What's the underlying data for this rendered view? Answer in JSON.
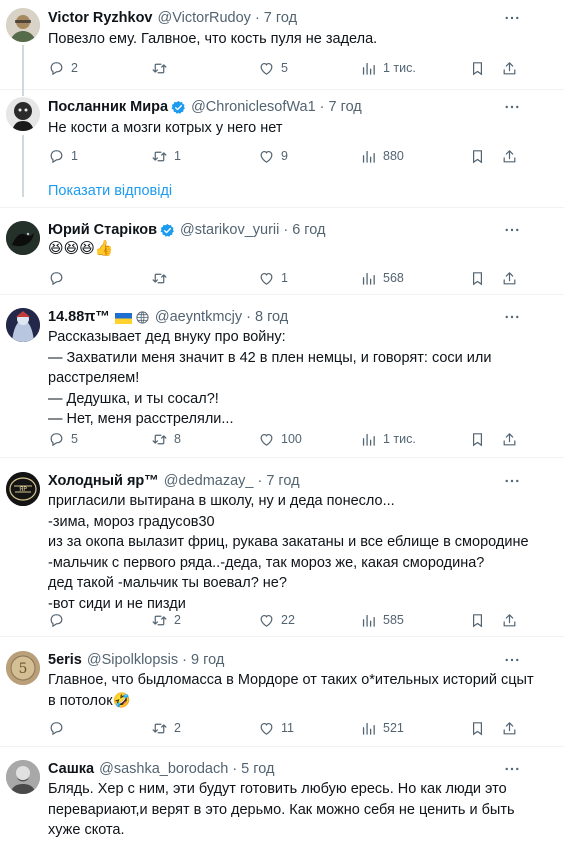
{
  "tweets": [
    {
      "name": "Victor Ryzhkov",
      "handle": "@VictorRudoy",
      "time": "7 год",
      "text": [
        "Повезло ему. Галвное, что кость пуля не задела."
      ],
      "replies": "2",
      "retweets": "",
      "likes": "5",
      "views": "1 тис."
    },
    {
      "name": "Посланник Мира",
      "handle": "@ChroniclesofWa1",
      "time": "7 год",
      "verified": true,
      "text": [
        "Не кости а мозги котрых у него нет"
      ],
      "replies": "1",
      "retweets": "1",
      "likes": "9",
      "views": "880"
    },
    {
      "name": "Юрий Старіков",
      "handle": "@starikov_yurii",
      "time": "6 год",
      "verified": true,
      "text": [
        "😆😆😆👍"
      ],
      "replies": "",
      "retweets": "",
      "likes": "1",
      "views": "568"
    },
    {
      "name": "14.88π™",
      "handle": "@aeyntkmcjy",
      "time": "8 год",
      "text": [
        "Рассказывает дед внуку про войну:",
        "— Захватили меня значит в 42 в плен немцы, и говорят: соси или",
        "расстреляем!",
        "— Дедушка, и ты сосал?!",
        "— Нет, меня расстреляли..."
      ],
      "replies": "5",
      "retweets": "8",
      "likes": "100",
      "views": "1 тис."
    },
    {
      "name": "Холодный яр™",
      "handle": "@dedmazay_",
      "time": "7 год",
      "text": [
        "пригласили вытирана в школу, ну и деда понесло...",
        "-зима, мороз градусов30",
        "из за окопа вылазит фриц, рукава закатаны и все еблище в смородине",
        "-мальчик с первого ряда..-деда, так мороз же, какая смородина?",
        "дед такой -мальчик ты воевал? не?",
        "-вот сиди и не пизди"
      ],
      "replies": "",
      "retweets": "2",
      "likes": "22",
      "views": "585"
    },
    {
      "name": "5eris",
      "handle": "@Sipolklopsis",
      "time": "9 год",
      "text": [
        "Главное, что быдломасса в Мордоре от таких о*ительных историй сцыт",
        "в потолок🤣"
      ],
      "replies": "",
      "retweets": "2",
      "likes": "11",
      "views": "521"
    },
    {
      "name": "Сашка",
      "handle": "@sashka_borodach",
      "time": "5 год",
      "text": [
        "Блядь. Хер с ним, эти будут готовить любую ересь. Но как люди это",
        "перевариают,и верят в это дерьмо. Как можно себя не ценить и быть",
        "хуже скота."
      ]
    }
  ],
  "show_replies": "Показати відповіді",
  "colors": {
    "accent": "#1d9bf0",
    "muted": "#536471",
    "text": "#0f1419",
    "verified": "#1d9bf0"
  },
  "icons": [
    "reply-icon",
    "retweet-icon",
    "like-icon",
    "views-icon",
    "bookmark-icon",
    "share-icon",
    "more-icon",
    "verified-badge-icon",
    "globe-icon",
    "ukraine-flag-icon"
  ]
}
